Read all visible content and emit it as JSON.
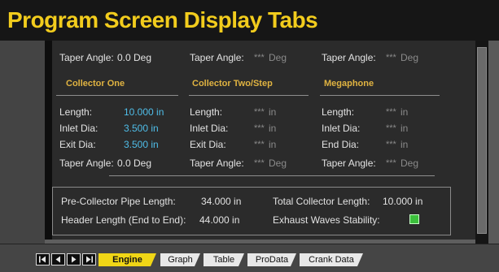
{
  "title": "Program Screen Display Tabs",
  "taper_top": {
    "c1_label": "Taper Angle:",
    "c1_value": "0.0 Deg",
    "c2_label": "Taper Angle:",
    "c2_ph": "***",
    "c2_unit": "Deg",
    "c3_label": "Taper Angle:",
    "c3_ph": "***",
    "c3_unit": "Deg"
  },
  "sections": {
    "collector_one": "Collector One",
    "collector_two": "Collector Two/Step",
    "megaphone": "Megaphone"
  },
  "collector_one": {
    "length_label": "Length:",
    "length_value": "10.000 in",
    "inlet_label": "Inlet Dia:",
    "inlet_value": "3.500 in",
    "exit_label": "Exit Dia:",
    "exit_value": "3.500 in",
    "taper_label": "Taper Angle:",
    "taper_value": "0.0 Deg"
  },
  "collector_two": {
    "length_label": "Length:",
    "inlet_label": "Inlet Dia:",
    "exit_label": "Exit Dia:",
    "taper_label": "Taper Angle:",
    "ph": "***",
    "unit_in": "in",
    "unit_deg": "Deg"
  },
  "megaphone": {
    "length_label": "Length:",
    "inlet_label": "Inlet Dia:",
    "end_label": "End Dia:",
    "taper_label": "Taper Angle:",
    "ph": "***",
    "unit_in": "in",
    "unit_deg": "Deg"
  },
  "summary": {
    "pre_collector_label": "Pre-Collector Pipe Length:",
    "pre_collector_value": "34.000 in",
    "total_collector_label": "Total Collector Length:",
    "total_collector_value": "10.000 in",
    "header_length_label": "Header Length (End to End):",
    "header_length_value": "44.000 in",
    "stability_label": "Exhaust Waves Stability:",
    "stability_color": "#3cc03c"
  },
  "tabs": [
    {
      "label": "Engine",
      "active": true
    },
    {
      "label": "Graph",
      "active": false
    },
    {
      "label": "Table",
      "active": false
    },
    {
      "label": "ProData",
      "active": false
    },
    {
      "label": "Crank Data",
      "active": false
    }
  ],
  "nav_icons": [
    "first-page-icon",
    "previous-page-icon",
    "next-page-icon",
    "last-page-icon"
  ],
  "colors": {
    "accent": "#f0d616",
    "title": "#f2cc1d",
    "value": "#4fbde8",
    "header": "#e0b341"
  }
}
